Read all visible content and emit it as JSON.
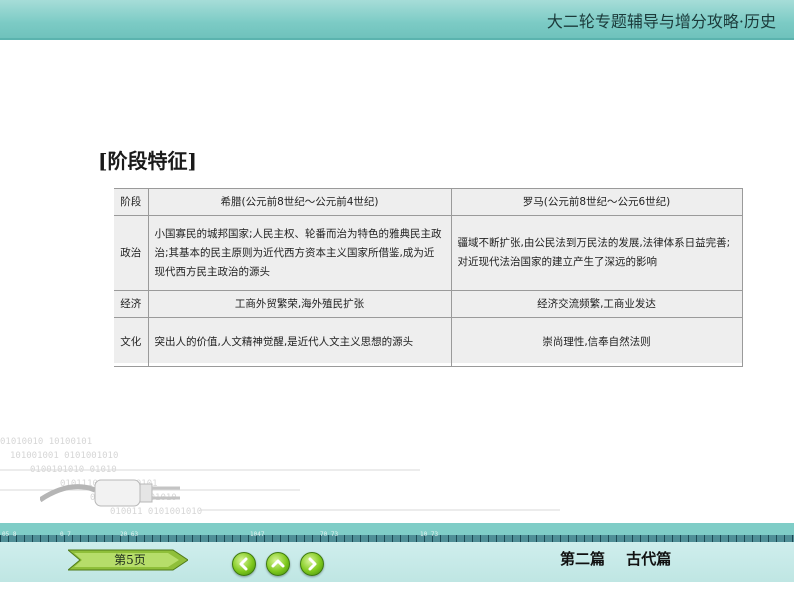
{
  "header": {
    "title": "大二轮专题辅导与增分攻略·历史"
  },
  "section": {
    "heading": "[阶段特征]"
  },
  "table": {
    "headers": [
      "阶段",
      "希腊(公元前8世纪～公元前4世纪)",
      "罗马(公元前8世纪～公元6世纪)"
    ],
    "rows": [
      {
        "label": "政治",
        "greece": "小国寡民的城邦国家;人民主权、轮番而治为特色的雅典民主政治;其基本的民主原则为近代西方资本主义国家所借鉴,成为近现代西方民主政治的源头",
        "rome": "疆域不断扩张,由公民法到万民法的发展,法律体系日益完善;对近现代法治国家的建立产生了深远的影响"
      },
      {
        "label": "经济",
        "greece": "工商外贸繁荣,海外殖民扩张",
        "rome": "经济交流频繁,工商业发达"
      },
      {
        "label": "文化",
        "greece": "突出人的价值,人文精神觉醒,是近代人文主义思想的源头",
        "rome": "崇尚理性,信奉自然法则"
      }
    ]
  },
  "footer": {
    "page": "第5页",
    "part": "第二篇  古代篇",
    "ruler_numbers": [
      "05 8",
      "0 7",
      "20 63",
      "1047",
      "70 73",
      "10 73"
    ]
  },
  "colors": {
    "header": "#7ccbc5",
    "bar": "#bfe6e3",
    "nav_button": "#7fc91d"
  },
  "icons": [
    "prev-arrow-icon",
    "up-arrow-icon",
    "next-arrow-icon",
    "plug-icon"
  ]
}
